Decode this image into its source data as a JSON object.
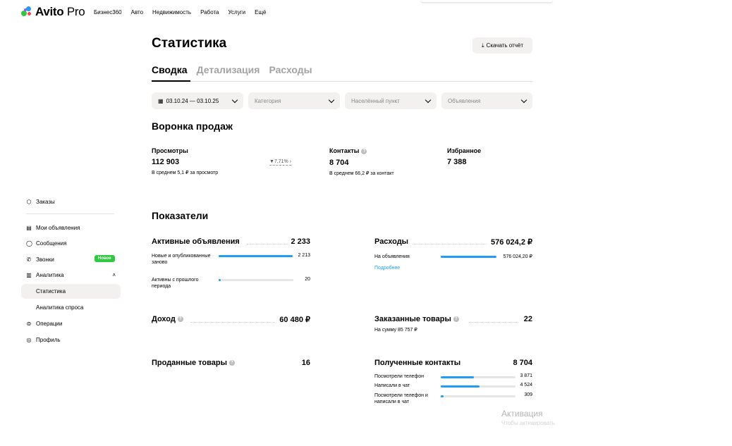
{
  "brand": {
    "logo_text": "Avito",
    "logo_pro": "Pro",
    "colors": {
      "green": "#2fc93f",
      "blue": "#1f9ef5",
      "red": "#ff4053",
      "purple": "#965eeb"
    }
  },
  "topnav": [
    "Бизнес360",
    "Авто",
    "Недвижимость",
    "Работа",
    "Услуги",
    "Ещё"
  ],
  "page": {
    "title": "Статистика",
    "download_label": "Скачать отчёт",
    "tabs": [
      "Сводка",
      "Детализация",
      "Расходы"
    ]
  },
  "filters": {
    "date": "03.10.24 — 03.10.25",
    "category": "Категория",
    "city": "Населённый пункт",
    "ads": "Объявления"
  },
  "funnel": {
    "title": "Воронка продаж",
    "views_label": "Просмотры",
    "views_value": "112 903",
    "views_sub": "В среднем 5,1 ₽ за просмотр",
    "trend": "7,71%",
    "contacts_label": "Контакты",
    "contacts_value": "8 704",
    "contacts_sub": "В среднем 66,2 ₽ за контакт",
    "fav_label": "Избранное",
    "fav_value": "7 388"
  },
  "sidebar": {
    "items": [
      {
        "label": "Заказы",
        "icon": "box-icon"
      },
      {
        "label": "Мои объявления",
        "icon": "list-icon"
      },
      {
        "label": "Сообщения",
        "icon": "chat-icon"
      },
      {
        "label": "Звонки",
        "icon": "phone-icon"
      },
      {
        "label": "Аналитика",
        "icon": "chart-icon"
      },
      {
        "label": "Статистика",
        "icon": ""
      },
      {
        "label": "Аналитика спроса",
        "icon": ""
      },
      {
        "label": "Операции",
        "icon": "operations-icon"
      },
      {
        "label": "Профиль",
        "icon": "profile-icon"
      }
    ],
    "new_badge": "Новое"
  },
  "indicators": {
    "title": "Показатели",
    "active": {
      "title": "Активные объявления",
      "value": "2 233",
      "rows": [
        {
          "label": "Новые и опубликованные заново",
          "value": "2 213",
          "fraction": 0.99
        },
        {
          "label": "Активны с прошлого периода",
          "value": "20",
          "fraction": 0.03
        }
      ]
    },
    "expenses": {
      "title": "Расходы",
      "value": "576 024,2 ₽",
      "rows": [
        {
          "label": "На объявления",
          "value": "576 024,20 ₽",
          "fraction": 1.0
        }
      ],
      "link": "Подробнее"
    },
    "income": {
      "title": "Доход",
      "value": "60 480 ₽"
    },
    "ordered": {
      "title": "Заказанные товары",
      "value": "22",
      "sub": "На сумму 85 757 ₽"
    },
    "sold": {
      "title": "Проданные товары",
      "value": "16"
    },
    "contacts": {
      "title": "Полученные контакты",
      "value": "8 704",
      "rows": [
        {
          "label": "Посмотрели телефон",
          "value": "3 871",
          "fraction": 0.44
        },
        {
          "label": "Написали в чат",
          "value": "4 524",
          "fraction": 0.52
        },
        {
          "label": "Посмотрели телефон и написали в чат",
          "value": "309",
          "fraction": 0.035
        }
      ]
    }
  },
  "watermark": {
    "line1": "Активация",
    "line2": "Чтобы активировать"
  }
}
